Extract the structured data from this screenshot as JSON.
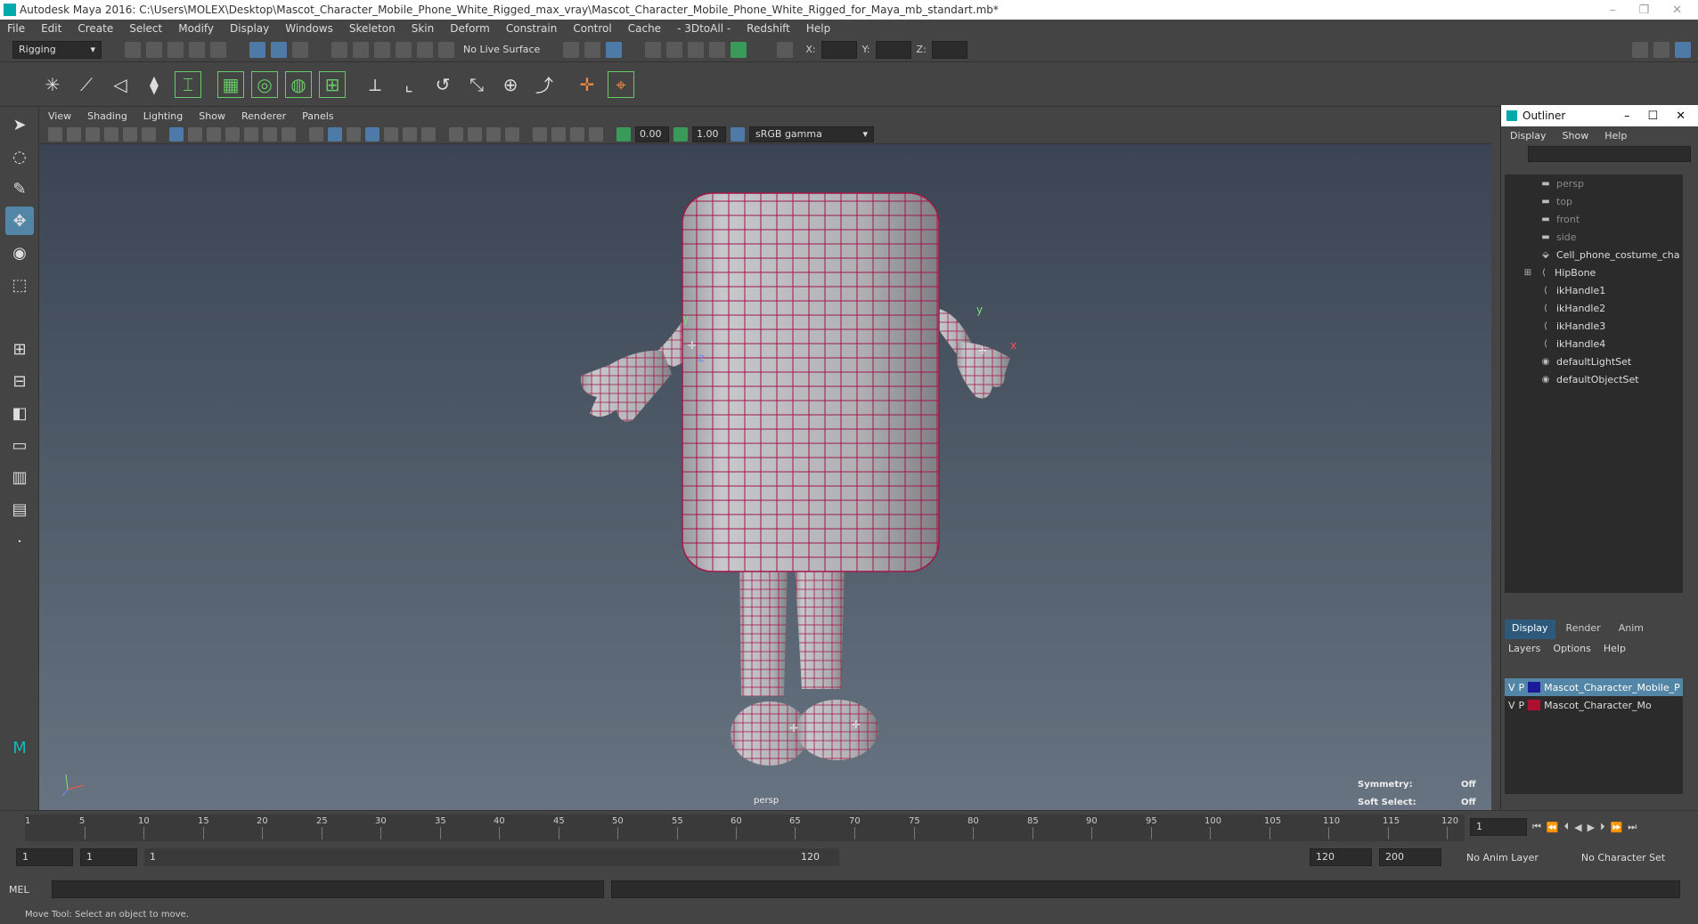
{
  "title": "Autodesk Maya 2016: C:\\Users\\MOLEX\\Desktop\\Mascot_Character_Mobile_Phone_White_Rigged_max_vray\\Mascot_Character_Mobile_Phone_White_Rigged_for_Maya_mb_standart.mb*",
  "menus": [
    "File",
    "Edit",
    "Create",
    "Select",
    "Modify",
    "Display",
    "Windows",
    "Skeleton",
    "Skin",
    "Deform",
    "Constrain",
    "Control",
    "Cache",
    "- 3DtoAll -",
    "Redshift",
    "Help"
  ],
  "status": {
    "mode": "Rigging",
    "live_surface": "No Live Surface",
    "x_label": "X:",
    "y_label": "Y:",
    "z_label": "Z:"
  },
  "panel": {
    "menus": [
      "View",
      "Shading",
      "Lighting",
      "Show",
      "Renderer",
      "Panels"
    ],
    "exposure": "0.00",
    "gamma": "1.00",
    "color_space": "sRGB gamma"
  },
  "viewport": {
    "camera": "persp",
    "symmetry_label": "Symmetry:",
    "symmetry_value": "Off",
    "soft_select_label": "Soft Select:",
    "soft_select_value": "Off",
    "axes": [
      "y",
      "z",
      "x"
    ]
  },
  "outliner": {
    "title": "Outliner",
    "menus": [
      "Display",
      "Show",
      "Help"
    ],
    "nodes": [
      {
        "label": "persp",
        "dim": true
      },
      {
        "label": "top",
        "dim": true
      },
      {
        "label": "front",
        "dim": true
      },
      {
        "label": "side",
        "dim": true
      },
      {
        "label": "Cell_phone_costume_cha",
        "dim": false
      },
      {
        "label": "HipBone",
        "dim": false
      },
      {
        "label": "ikHandle1",
        "dim": false
      },
      {
        "label": "ikHandle2",
        "dim": false
      },
      {
        "label": "ikHandle3",
        "dim": false
      },
      {
        "label": "ikHandle4",
        "dim": false
      },
      {
        "label": "defaultLightSet",
        "dim": false
      },
      {
        "label": "defaultObjectSet",
        "dim": false
      }
    ],
    "tabs": [
      "Display",
      "Render",
      "Anim"
    ],
    "layer_menus": [
      "Layers",
      "Options",
      "Help"
    ],
    "layers": [
      {
        "v": "V",
        "p": "P",
        "name": "Mascot_Character_Mobile_P",
        "color": "#1a1a9a"
      },
      {
        "v": "V",
        "p": "P",
        "name": "Mascot_Character_Mo",
        "color": "#b01030"
      }
    ]
  },
  "timeline": {
    "ticks": [
      "5",
      "10",
      "15",
      "20",
      "25",
      "30",
      "35",
      "40",
      "45",
      "50",
      "55",
      "60",
      "65",
      "70",
      "75",
      "80",
      "85",
      "90",
      "95",
      "100",
      "105",
      "110",
      "115",
      "120"
    ],
    "start_label": "1",
    "current_frame": "1"
  },
  "range": {
    "start": "1",
    "playback_start": "1",
    "range_start": "1",
    "range_end": "120",
    "playback_end": "120",
    "end": "200",
    "anim_layer": "No Anim Layer",
    "character_set": "No Character Set"
  },
  "cmd": {
    "label": "MEL"
  },
  "help_line": "Move Tool: Select an object to move."
}
